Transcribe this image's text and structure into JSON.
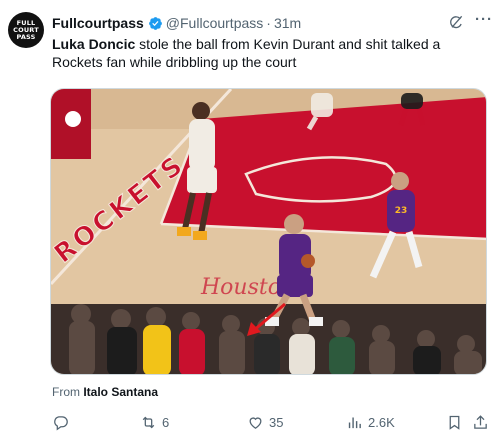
{
  "avatar": {
    "text": "FULL COURT PASS"
  },
  "author": {
    "display_name": "Fullcourtpass",
    "handle": "@Fullcourtpass",
    "separator": "·",
    "time": "31m"
  },
  "tweet": {
    "text_bold": "Luka Doncic",
    "text_rest": " stole the ball from Kevin Durant and shit talked a Rockets fan while dribbling up the court"
  },
  "media": {
    "court_lettering": "ROCKETS",
    "center_lettering": "Houston",
    "jersey_number": "23"
  },
  "from": {
    "prefix": "From ",
    "name": "Italo Santana"
  },
  "actions": {
    "replies": "",
    "reposts": "6",
    "likes": "35",
    "views": "2.6K"
  },
  "colors": {
    "court_red": "#c8102e",
    "court_wood": "#e5c8a4",
    "lakers_purple": "#552583",
    "verified_blue": "#1d9bf0",
    "arrow_red": "#e0191f"
  },
  "icons": [
    "verified-icon",
    "grok-icon",
    "more-icon",
    "reply-icon",
    "repost-icon",
    "like-icon",
    "views-icon",
    "bookmark-icon",
    "share-icon"
  ]
}
